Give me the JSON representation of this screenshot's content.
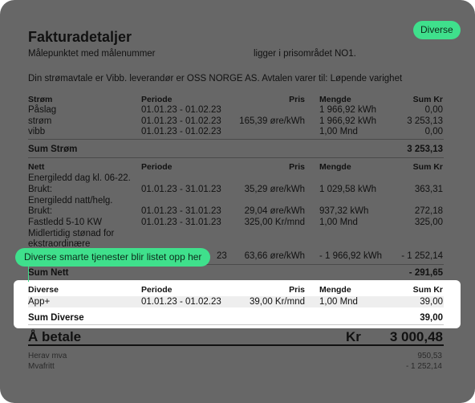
{
  "badge": "Diverse",
  "title": "Fakturadetaljer",
  "meter_line": {
    "left": "Målepunktet med målenummer",
    "right": "ligger i prisområdet NO1."
  },
  "contract": "Din strømavtale er Vibb. leverandør er OSS NORGE AS. Avtalen varer til: Løpende varighet",
  "strom": {
    "headers": {
      "name": "Strøm",
      "period": "Periode",
      "price": "Pris",
      "qty": "Mengde",
      "sum": "Sum Kr"
    },
    "rows": [
      {
        "name": "Påslag",
        "period": "01.01.23 - 01.02.23",
        "price": "",
        "qty": "1 966,92 kWh",
        "sum": "0,00"
      },
      {
        "name": "strøm",
        "period": "01.01.23 - 01.02.23",
        "price": "165,39 øre/kWh",
        "qty": "1 966,92 kWh",
        "sum": "3 253,13"
      },
      {
        "name": "vibb",
        "period": "01.01.23 - 01.02.23",
        "price": "",
        "qty": "1,00 Mnd",
        "sum": "0,00"
      }
    ],
    "total_label": "Sum Strøm",
    "total": "3 253,13"
  },
  "nett": {
    "headers": {
      "name": "Nett",
      "period": "Periode",
      "price": "Pris",
      "qty": "Mengde",
      "sum": "Sum Kr"
    },
    "line1": "Energiledd dag kl. 06-22.",
    "row1": {
      "name": "Brukt:",
      "period": "01.01.23 - 31.01.23",
      "price": "35,29 øre/kWh",
      "qty": "1 029,58 kWh",
      "sum": "363,31"
    },
    "line2": "Energiledd natt/helg.",
    "row2": {
      "name": "Brukt:",
      "period": "01.01.23 - 31.01.23",
      "price": "29,04 øre/kWh",
      "qty": "937,32 kWh",
      "sum": "272,18"
    },
    "row3": {
      "name": "Fastledd 5-10 KW",
      "period": "01.01.23 - 31.01.23",
      "price": "325,00 Kr/mnd",
      "qty": "1,00 Mnd",
      "sum": "325,00"
    },
    "line3a": "Midlertidig stønad for",
    "line3b": "ekstraordinære",
    "row4": {
      "period_tail": "23",
      "price": "63,66 øre/kWh",
      "qty": "- 1 966,92 kWh",
      "sum": "- 1 252,14"
    },
    "total_label": "Sum Nett",
    "total": "- 291,65"
  },
  "tooltip": "Diverse smarte tjenester blir listet opp her",
  "diverse": {
    "headers": {
      "name": "Diverse",
      "period": "Periode",
      "price": "Pris",
      "qty": "Mengde",
      "sum": "Sum Kr"
    },
    "row": {
      "name": "App+",
      "period": "01.01.23 - 01.02.23",
      "price": "39,00 Kr/mnd",
      "qty": "1,00 Mnd",
      "sum": "39,00"
    },
    "total_label": "Sum Diverse",
    "total": "39,00"
  },
  "pay": {
    "label": "Å betale",
    "currency": "Kr",
    "amount": "3 000,48"
  },
  "footer": [
    {
      "label": "Herav mva",
      "value": "950,53"
    },
    {
      "label": "Mvafritt",
      "value": "- 1 252,14"
    }
  ]
}
